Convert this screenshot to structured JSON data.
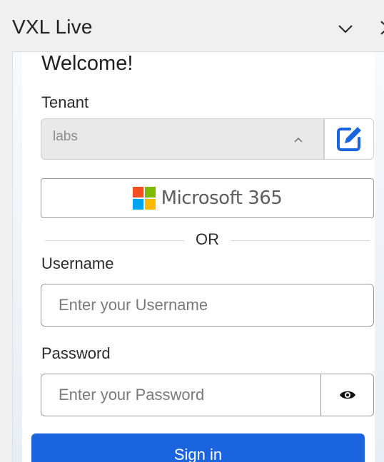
{
  "window": {
    "title": "VXL Live"
  },
  "form": {
    "heading": "Welcome!",
    "tenant_label": "Tenant",
    "tenant_value": "labs",
    "microsoft_label": "Microsoft 365",
    "or_label": "OR",
    "username_label": "Username",
    "username_placeholder": "Enter your Username",
    "username_value": "",
    "password_label": "Password",
    "password_placeholder": "Enter your Password",
    "password_value": "",
    "signin_label": "Sign in"
  },
  "colors": {
    "primary": "#1a64e0",
    "ms_red": "#f25022",
    "ms_green": "#7fba00",
    "ms_blue": "#00a4ef",
    "ms_yellow": "#ffb900"
  },
  "icons": {
    "window_chevron": "chevron-down-icon",
    "window_close": "close-icon",
    "tenant_caret": "chevron-up-icon",
    "tenant_edit": "edit-icon",
    "microsoft": "microsoft-logo-icon",
    "password_toggle": "eye-icon"
  }
}
